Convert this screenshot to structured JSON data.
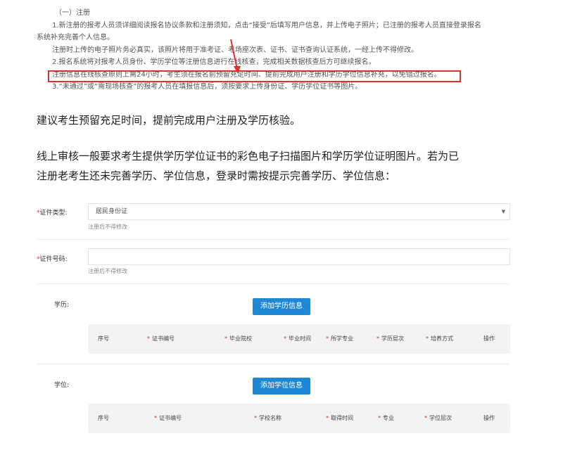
{
  "notice": {
    "heading": "（一）注册",
    "lines": [
      "1.新注册的报考人员须详细阅读报名协议条款和注册须知，点击“接受”后填写用户信息，并上传电子照片；已注册的报考人员直接登录报名",
      "系统补充完善个人信息。",
      "注册时上传的电子照片务必真实，该照片将用于准考证、考场座次表、证书、证书查询认证系统，一经上传不得修改。",
      "2.报名系统将对报考人员身份、学历学位等注册信息进行在线核查，完成相关数据核查后方可继续报名。",
      "注册信息在线核查原则上需24小时，考生须在报名前预留充足时间、提前完成用户注册和学历学位信息补充，以免错过报名。",
      "3.“未通过”或“需现场核查”的报考人员在填报信息后，须按要求上传身份证、学历学位证书等图片。"
    ]
  },
  "paragraph1": "建议考生预留充足时间，提前完成用户注册及学历核验。",
  "paragraph2_line1": "线上审核一般要求考生提供学历学位证书的彩色电子扫描图片和学历学位证明图片。若为已",
  "paragraph2_line2": "注册老考生还未完善学历、学位信息，登录时需按提示完善学历、学位信息：",
  "form": {
    "id_type_label": "证件类型:",
    "id_type_value": "居民身份证",
    "id_type_hint": "注册后不得修改",
    "id_number_label": "证件号码:",
    "id_number_value": "",
    "id_number_hint": "注册后不得修改",
    "required_mark": "*",
    "education_label": "学历:",
    "add_education_button": "添加学历信息",
    "education_columns": [
      {
        "label": "序号",
        "required": false
      },
      {
        "label": "证书编号",
        "required": true
      },
      {
        "label": "毕业院校",
        "required": true
      },
      {
        "label": "毕业时间",
        "required": true
      },
      {
        "label": "所学专业",
        "required": true
      },
      {
        "label": "学历层次",
        "required": true
      },
      {
        "label": "培养方式",
        "required": true
      },
      {
        "label": "操作",
        "required": false
      }
    ],
    "degree_label": "学位:",
    "add_degree_button": "添加学位信息",
    "degree_columns": [
      {
        "label": "序号",
        "required": false
      },
      {
        "label": "证书编号",
        "required": true
      },
      {
        "label": "学校名称",
        "required": true
      },
      {
        "label": "取得时间",
        "required": true
      },
      {
        "label": "专业",
        "required": true
      },
      {
        "label": "学位层次",
        "required": true
      },
      {
        "label": "操作",
        "required": false
      }
    ]
  },
  "colors": {
    "highlight_border": "#e03030",
    "button_bg": "#1e88d6",
    "required": "#e03030"
  }
}
